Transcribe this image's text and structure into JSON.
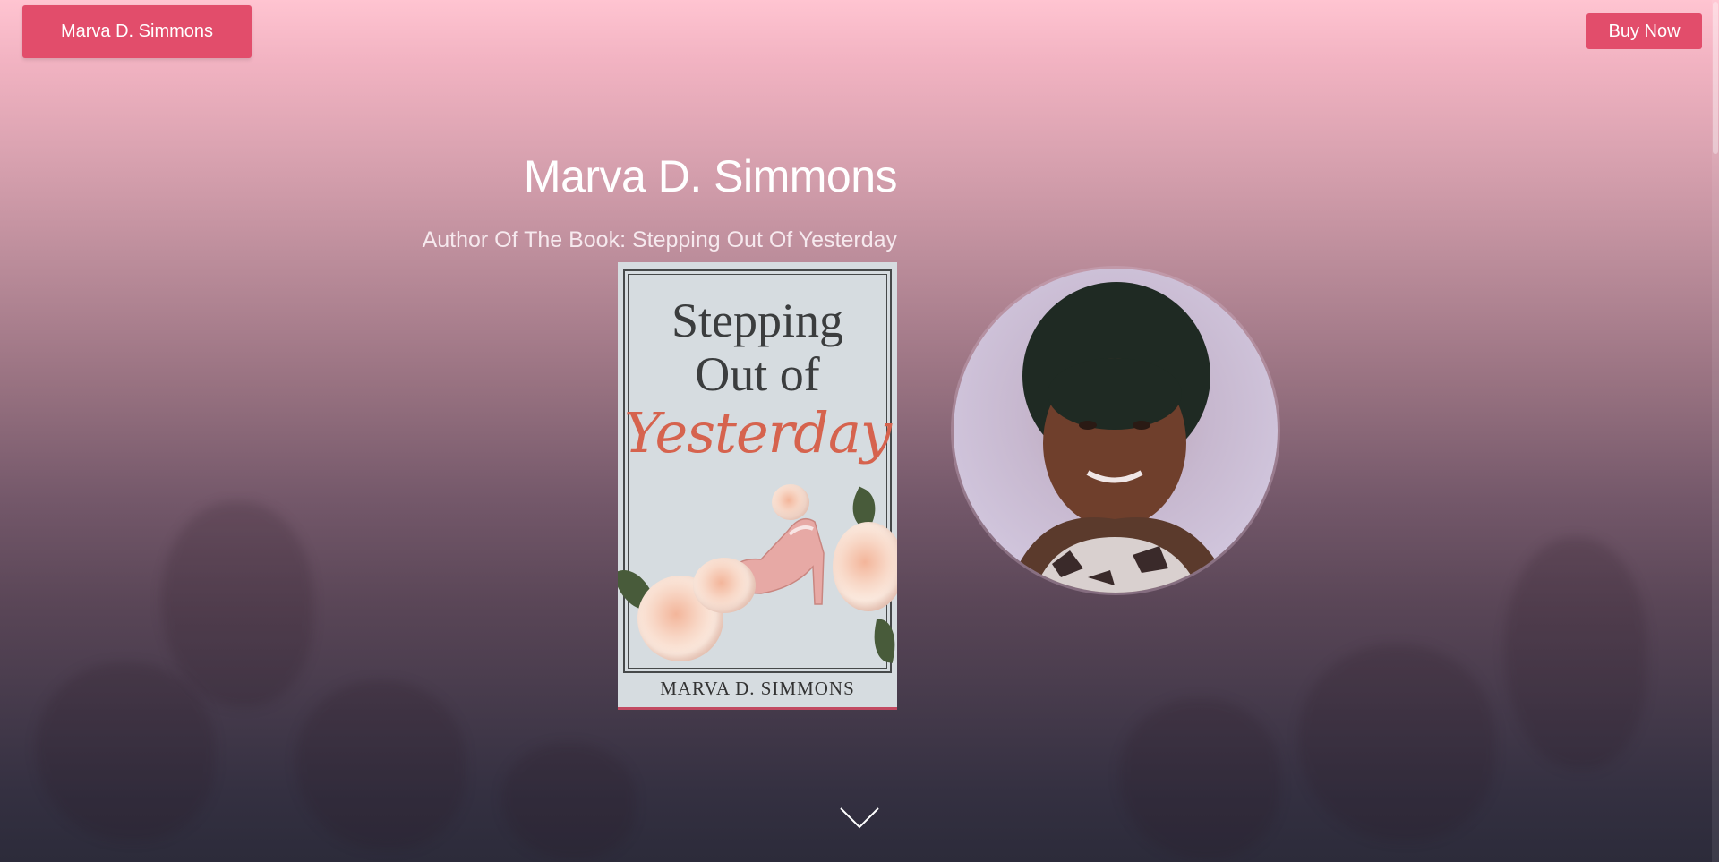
{
  "header": {
    "brand_label": "Marva D. Simmons",
    "buy_label": "Buy Now"
  },
  "hero": {
    "title": "Marva D. Simmons",
    "subtitle": "Author Of The Book: Stepping Out Of Yesterday"
  },
  "book": {
    "line1": "Stepping",
    "line2": "Out of",
    "line3": "Yesterday",
    "author": "MARVA D. SIMMONS"
  },
  "icons": {
    "scroll_down": "chevron-down-icon"
  },
  "colors": {
    "accent": "#e24d6b",
    "book_title_script": "#d6634e"
  }
}
